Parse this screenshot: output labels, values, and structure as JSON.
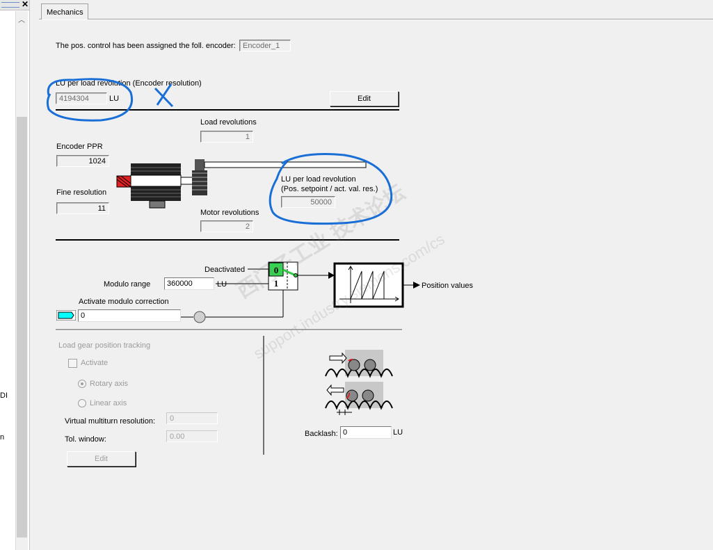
{
  "left_panel": {
    "texts": [
      "DI",
      "n"
    ]
  },
  "tab": {
    "label": "Mechanics"
  },
  "encoder": {
    "label": "The pos. control has been assigned the foll. encoder:",
    "value": "Encoder_1"
  },
  "lu_encoder": {
    "label": "LU per load revolution (Encoder resolution)",
    "value": "4194304",
    "unit": "LU",
    "edit_label": "Edit"
  },
  "gear": {
    "load_rev_label": "Load revolutions",
    "load_rev_value": "1",
    "encoder_ppr_label": "Encoder PPR",
    "encoder_ppr_value": "1024",
    "fine_res_label": "Fine resolution",
    "fine_res_value": "11",
    "motor_rev_label": "Motor revolutions",
    "motor_rev_value": "2",
    "lu_load_label1": "LU per load revolution",
    "lu_load_label2": "(Pos. setpoint / act. val. res.)",
    "lu_load_value": "50000"
  },
  "modulo": {
    "deactivated_label": "Deactivated",
    "switch_0": "0",
    "switch_1": "1",
    "range_label": "Modulo range",
    "range_value": "360000",
    "range_unit": "LU",
    "correction_label": "Activate modulo correction",
    "correction_value": "0",
    "output_label": "Position values"
  },
  "tracking": {
    "title": "Load gear position tracking",
    "activate_label": "Activate",
    "rotary_label": "Rotary axis",
    "linear_label": "Linear axis",
    "multiturn_label": "Virtual multiturn resolution:",
    "multiturn_value": "0",
    "tol_label": "Tol. window:",
    "tol_value": "0.00",
    "edit_label": "Edit"
  },
  "backlash": {
    "label": "Backlash:",
    "value": "0",
    "unit": "LU"
  },
  "watermark": {
    "line1": "西门子工业  技术论坛",
    "line2": "support.industry.siemens.com/cs"
  },
  "colors": {
    "annotation": "#1a6fd6",
    "switch_active": "#2ecc40",
    "connector": "#00ffff",
    "brake_red": "#e02020"
  }
}
